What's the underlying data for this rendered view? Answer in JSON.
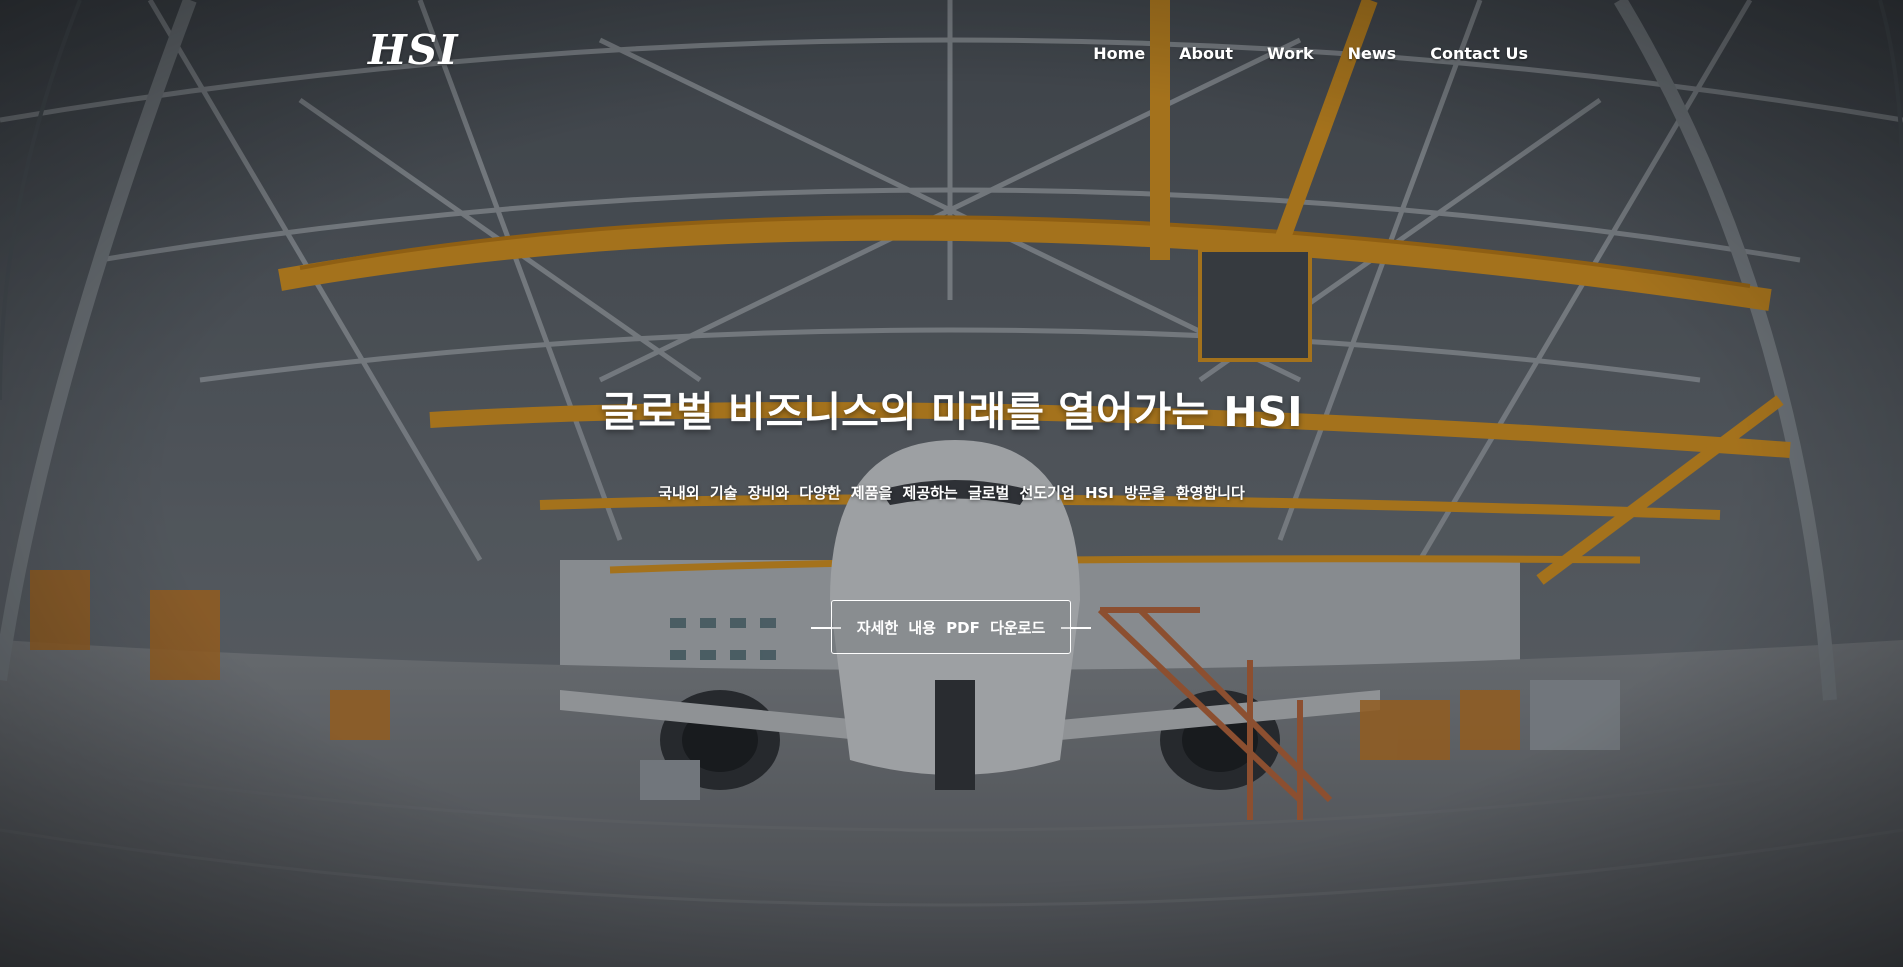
{
  "header": {
    "logo": "HSI",
    "nav": [
      {
        "label": "Home"
      },
      {
        "label": "About"
      },
      {
        "label": "Work"
      },
      {
        "label": "News"
      },
      {
        "label": "Contact Us"
      }
    ]
  },
  "hero": {
    "title": "글로벌 비즈니스의 미래를 열어가는 HSI",
    "subtitle": "국내외 기술 장비와 다양한 제품을 제공하는 글로벌 선도기업 HSI 방문을 환영합니다",
    "cta_label": "자세한 내용 PDF 다운로드",
    "background": "aircraft-hangar-photo"
  },
  "colors": {
    "text": "#ffffff",
    "crane_orange": "#e39a1e",
    "structure_gray": "#9aa1a8",
    "floor": "#6d7075"
  }
}
